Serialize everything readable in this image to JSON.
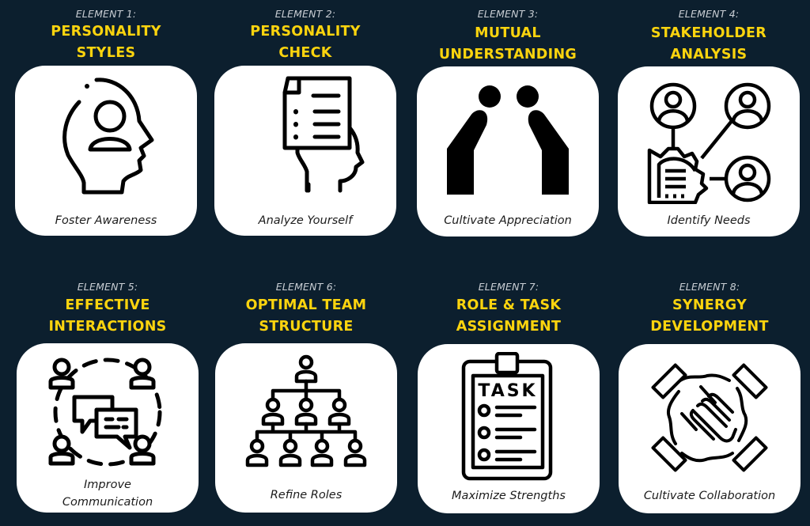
{
  "colors": {
    "background": "#0c1f2e",
    "title": "#fcd40e",
    "label": "#c9ced4",
    "card": "#ffffff",
    "icon": "#000000"
  },
  "elements": [
    {
      "label": "ELEMENT 1:",
      "title_line1": "PERSONALITY",
      "title_line2": "STYLES",
      "caption_line1": "Foster Awareness",
      "caption_line2": "",
      "icon": "head-profile-person-icon"
    },
    {
      "label": "ELEMENT 2:",
      "title_line1": "PERSONALITY",
      "title_line2": "CHECK",
      "caption_line1": "Analyze Yourself",
      "caption_line2": "",
      "icon": "document-head-icon"
    },
    {
      "label": "ELEMENT 3:",
      "title_line1": "MUTUAL",
      "title_line2": "UNDERSTANDING",
      "caption_line1": "Cultivate Appreciation",
      "caption_line2": "",
      "icon": "two-people-bowing-icon"
    },
    {
      "label": "ELEMENT 4:",
      "title_line1": "STAKEHOLDER",
      "title_line2": "ANALYSIS",
      "caption_line1": "Identify Needs",
      "caption_line2": "",
      "icon": "stakeholder-network-icon"
    },
    {
      "label": "ELEMENT 5:",
      "title_line1": "EFFECTIVE",
      "title_line2": "INTERACTIONS",
      "caption_line1": "Improve",
      "caption_line2": "Communication",
      "icon": "group-chat-icon"
    },
    {
      "label": "ELEMENT 6:",
      "title_line1": "OPTIMAL TEAM",
      "title_line2": "STRUCTURE",
      "caption_line1": "Refine Roles",
      "caption_line2": "",
      "icon": "org-chart-icon"
    },
    {
      "label": "ELEMENT 7:",
      "title_line1": "ROLE & TASK",
      "title_line2": "ASSIGNMENT",
      "caption_line1": "Maximize Strengths",
      "caption_line2": "",
      "icon": "task-clipboard-icon"
    },
    {
      "label": "ELEMENT 8:",
      "title_line1": "SYNERGY",
      "title_line2": "DEVELOPMENT",
      "caption_line1": "Cultivate Collaboration",
      "caption_line2": "",
      "icon": "stacked-hands-icon"
    }
  ]
}
